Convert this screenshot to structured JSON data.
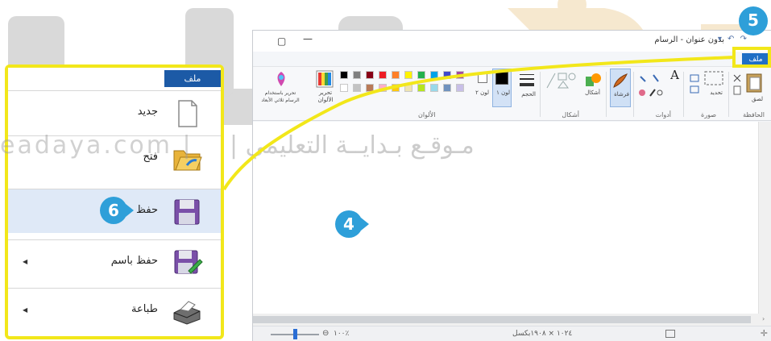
{
  "watermark": {
    "latin": "eadaya.com |",
    "arabic": "مـوقـع بـدايــة التعليمي |"
  },
  "paint": {
    "title": "بدون عنوان - الرسام",
    "file_tab": "ملف",
    "groups": {
      "clipboard": "الحافظة",
      "image": "صورة",
      "tools": "أدوات",
      "shapes": "أشكال",
      "colors": "الألوان"
    },
    "buttons": {
      "paste": "لصق",
      "select": "تحديد",
      "brush": "فرشاة",
      "shapes": "أشكال",
      "size": "الحجم",
      "color1": "لون ١",
      "color2": "لون ٢",
      "edit_colors": "تحرير الألوان",
      "paint3d": "تحرير باستخدام الرسام ثلاثي الأبعاد"
    },
    "palette": [
      "#000000",
      "#7f7f7f",
      "#880015",
      "#ed1c24",
      "#ff7f27",
      "#fff200",
      "#22b14c",
      "#00a2e8",
      "#3f48cc",
      "#a349a4",
      "#ffffff",
      "#c3c3c3",
      "#b97a57",
      "#ffaec9",
      "#ffc90e",
      "#efe4b0",
      "#b5e61d",
      "#99d9ea",
      "#7092be",
      "#c8bfe7"
    ],
    "status": {
      "size": "١٠٢٤ × ١٩٠٨بكسل",
      "zoom": "١٠٠٪"
    }
  },
  "file_menu": {
    "title": "ملف",
    "items": [
      {
        "label": "جديد",
        "has_arrow": false
      },
      {
        "label": "فتح",
        "has_arrow": false
      },
      {
        "label": "حفظ",
        "has_arrow": false
      },
      {
        "label": "حفظ باسم",
        "has_arrow": true
      },
      {
        "label": "طباعة",
        "has_arrow": true
      }
    ]
  },
  "callouts": {
    "step4": "4",
    "step5": "5",
    "step6": "6"
  },
  "colors": {
    "highlight": "#f2e71a",
    "badge": "#2e9fd9",
    "file_blue": "#1c5aa6"
  }
}
